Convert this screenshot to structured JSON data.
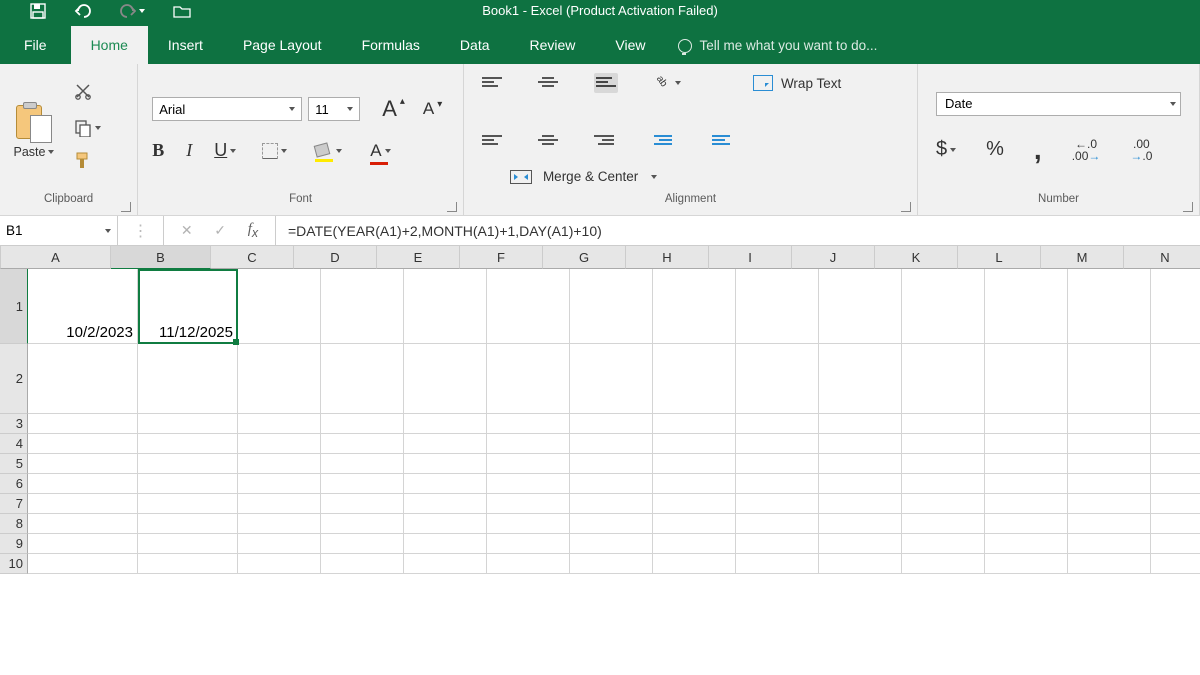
{
  "title": "Book1 - Excel (Product Activation Failed)",
  "tabs": {
    "file": "File",
    "home": "Home",
    "insert": "Insert",
    "pagelayout": "Page Layout",
    "formulas": "Formulas",
    "data": "Data",
    "review": "Review",
    "view": "View",
    "tellme": "Tell me what you want to do..."
  },
  "ribbon": {
    "clipboard": {
      "paste": "Paste",
      "label": "Clipboard"
    },
    "font": {
      "name": "Arial",
      "size": "11",
      "bold": "B",
      "italic": "I",
      "underline": "U",
      "colorA": "A",
      "increaseA": "A",
      "decreaseA": "A",
      "label": "Font"
    },
    "alignment": {
      "wrap": "Wrap Text",
      "merge": "Merge & Center",
      "label": "Alignment"
    },
    "number": {
      "format": "Date",
      "label": "Number",
      "dollar": "$",
      "percent": "%",
      "comma": ",",
      "inc_dec_top": ".0",
      "inc_dec_bot": ".00",
      "dec_inc_top": ".00",
      "dec_inc_bot": ".0"
    }
  },
  "namebox": "B1",
  "formula": "=DATE(YEAR(A1)+2,MONTH(A1)+1,DAY(A1)+10)",
  "columns": [
    "A",
    "B",
    "C",
    "D",
    "E",
    "F",
    "G",
    "H",
    "I",
    "J",
    "K",
    "L",
    "M",
    "N"
  ],
  "rows": [
    "1",
    "2",
    "3",
    "4",
    "5",
    "6",
    "7",
    "8",
    "9",
    "10"
  ],
  "cells": {
    "A1": "10/2/2023",
    "B1": "11/12/2025"
  }
}
